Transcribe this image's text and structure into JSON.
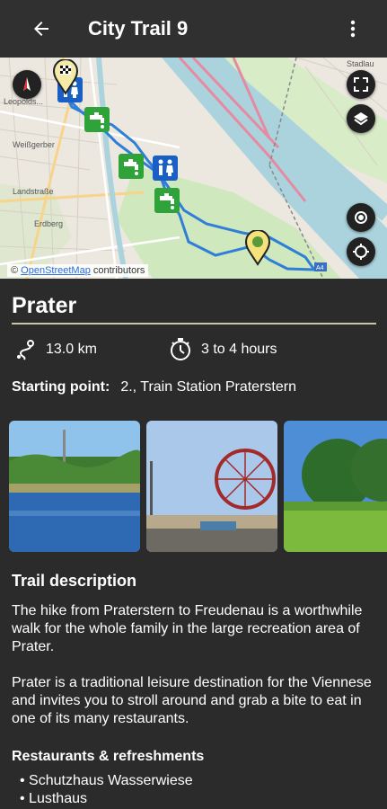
{
  "appbar": {
    "title": "City Trail 9",
    "back_icon": "arrow-back-icon",
    "menu_icon": "more-vert-icon"
  },
  "map": {
    "attribution_prefix": "©",
    "attribution_link": "OpenStreetMap",
    "attribution_suffix": "contributors",
    "labels": {
      "leopoldstadt": "Leopolds...",
      "weissgerber": "Weißgerber",
      "landstrasse": "Landstraße",
      "erdberg": "Erdberg",
      "stadlau": "Stadlau",
      "scale": "A4"
    },
    "buttons": [
      "compass-icon",
      "fullscreen-icon",
      "layers-icon",
      "my-location-icon",
      "locate-icon"
    ]
  },
  "trail": {
    "name": "Prater",
    "distance": "13.0 km",
    "duration": "3 to 4 hours",
    "starting_point_label": "Starting point:",
    "starting_point": "2., Train Station Praterstern"
  },
  "description": {
    "title": "Trail description",
    "p1": "The hike from Praterstern to Freudenau is a worthwhile walk for the whole family in the large recreation area of Prater.",
    "p2": "Prater is a traditional leisure destination for the Viennese and invites you to stroll around and grab a bite to eat in one of its many restaurants."
  },
  "restaurants": {
    "title": "Restaurants & refreshments",
    "items": [
      "Schutzhaus Wasserwiese",
      "Lusthaus"
    ]
  },
  "colors": {
    "background": "#2b2b2b",
    "appbar": "#303030",
    "route": "#2f7fd8",
    "accent_line": "#c9c7a0"
  }
}
